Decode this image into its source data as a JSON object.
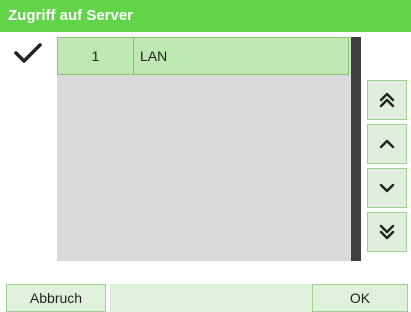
{
  "header": {
    "title": "Zugriff auf Server"
  },
  "list": {
    "selected_indicator_icon": "checkmark-icon",
    "rows": [
      {
        "number": "1",
        "name": "LAN",
        "selected": true
      }
    ]
  },
  "navigation": {
    "page_up_icon": "double-chevron-up-icon",
    "up_icon": "chevron-up-icon",
    "down_icon": "chevron-down-icon",
    "page_down_icon": "double-chevron-down-icon"
  },
  "footer": {
    "cancel_label": "Abbruch",
    "ok_label": "OK"
  },
  "colors": {
    "accent": "#62d44a",
    "row_selected": "#bde7b3",
    "list_background": "#dadada",
    "scrollbar": "#3e3e3e",
    "button_background": "#dff0db"
  }
}
